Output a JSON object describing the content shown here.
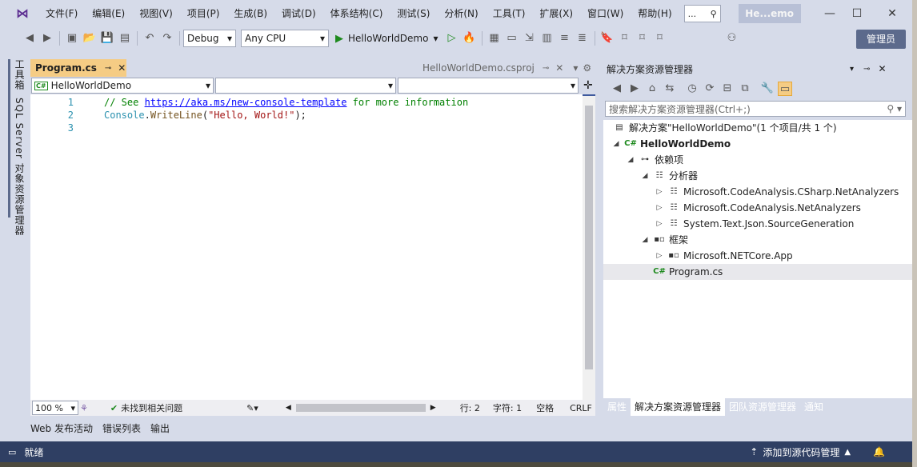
{
  "menu": [
    "文件(F)",
    "编辑(E)",
    "视图(V)",
    "项目(P)",
    "生成(B)",
    "调试(D)",
    "体系结构(C)",
    "测试(S)",
    "分析(N)",
    "工具(T)",
    "扩展(X)",
    "窗口(W)",
    "帮助(H)"
  ],
  "search_label": "...",
  "solution_title": "He...emo",
  "toolbar": {
    "config": "Debug",
    "platform": "Any CPU",
    "run_target": "HelloWorldDemo",
    "admin_label": "管理员"
  },
  "side_tabs": [
    "工具箱",
    "SQL Server 对象资源管理器"
  ],
  "editor": {
    "active_tab": "Program.cs",
    "inactive_tab": "HelloWorldDemo.csproj",
    "nav_project": "HelloWorldDemo",
    "nav_project_icon": "C#",
    "lines": [
      {
        "n": "1",
        "parts": [
          {
            "t": "// See ",
            "c": "cm"
          },
          {
            "t": "https://aka.ms/new-console-template",
            "c": "url"
          },
          {
            "t": " for more information",
            "c": "cm"
          }
        ]
      },
      {
        "n": "2",
        "parts": [
          {
            "t": "Console",
            "c": "cls"
          },
          {
            "t": ".",
            "c": ""
          },
          {
            "t": "WriteLine",
            "c": "mth"
          },
          {
            "t": "(",
            "c": ""
          },
          {
            "t": "\"Hello, World!\"",
            "c": "str"
          },
          {
            "t": ");",
            "c": ""
          }
        ]
      },
      {
        "n": "3",
        "parts": []
      }
    ],
    "zoom": "100 %",
    "issues": "未找到相关问题",
    "line_pos": "行: 2",
    "char_pos": "字符: 1",
    "whitespace": "空格",
    "eol": "CRLF"
  },
  "bottom_tabs": [
    "Web 发布活动",
    "错误列表",
    "输出"
  ],
  "solution_explorer": {
    "title": "解决方案资源管理器",
    "search_placeholder": "搜索解决方案资源管理器(Ctrl+;)",
    "tree": [
      {
        "label": "解决方案\"HelloWorldDemo\"(1 个项目/共 1 个)",
        "icon": "solution-icon",
        "expander": "",
        "bold": false
      },
      {
        "label": "HelloWorldDemo",
        "icon": "csharp-project-icon",
        "expander": "◢",
        "bold": true
      },
      {
        "label": "依赖项",
        "icon": "dependencies-icon",
        "expander": "◢",
        "bold": false
      },
      {
        "label": "分析器",
        "icon": "analyzer-icon",
        "expander": "◢",
        "bold": false
      },
      {
        "label": "Microsoft.CodeAnalysis.CSharp.NetAnalyzers",
        "icon": "analyzer-package-icon",
        "expander": "▷",
        "bold": false
      },
      {
        "label": "Microsoft.CodeAnalysis.NetAnalyzers",
        "icon": "analyzer-package-icon",
        "expander": "▷",
        "bold": false
      },
      {
        "label": "System.Text.Json.SourceGeneration",
        "icon": "analyzer-package-icon",
        "expander": "▷",
        "bold": false
      },
      {
        "label": "框架",
        "icon": "framework-icon",
        "expander": "◢",
        "bold": false
      },
      {
        "label": "Microsoft.NETCore.App",
        "icon": "framework-package-icon",
        "expander": "▷",
        "bold": false
      },
      {
        "label": "Program.cs",
        "icon": "csharp-file-icon",
        "expander": "",
        "bold": false
      }
    ],
    "bottom_tabs": [
      "属性",
      "解决方案资源管理器",
      "团队资源管理器",
      "通知"
    ]
  },
  "status": {
    "ready": "就绪",
    "source_control": "添加到源代码管理"
  }
}
